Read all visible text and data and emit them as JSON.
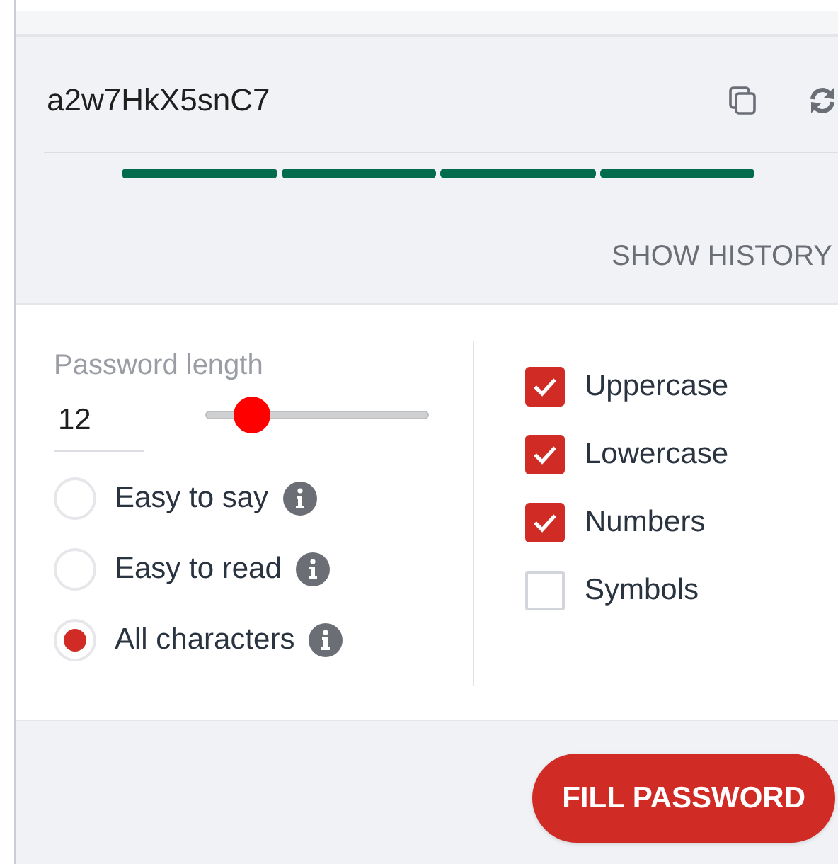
{
  "password": {
    "value": "a2w7HkX5snC7"
  },
  "show_history": "SHOW HISTORY",
  "length": {
    "label": "Password length",
    "value": "12",
    "level": 0.21
  },
  "modes": [
    {
      "label": "Easy to say",
      "selected": false
    },
    {
      "label": "Easy to read",
      "selected": false
    },
    {
      "label": "All characters",
      "selected": true
    }
  ],
  "options": [
    {
      "label": "Uppercase",
      "checked": true
    },
    {
      "label": "Lowercase",
      "checked": true
    },
    {
      "label": "Numbers",
      "checked": true
    },
    {
      "label": "Symbols",
      "checked": false
    }
  ],
  "fill_button": "FILL PASSWORD"
}
